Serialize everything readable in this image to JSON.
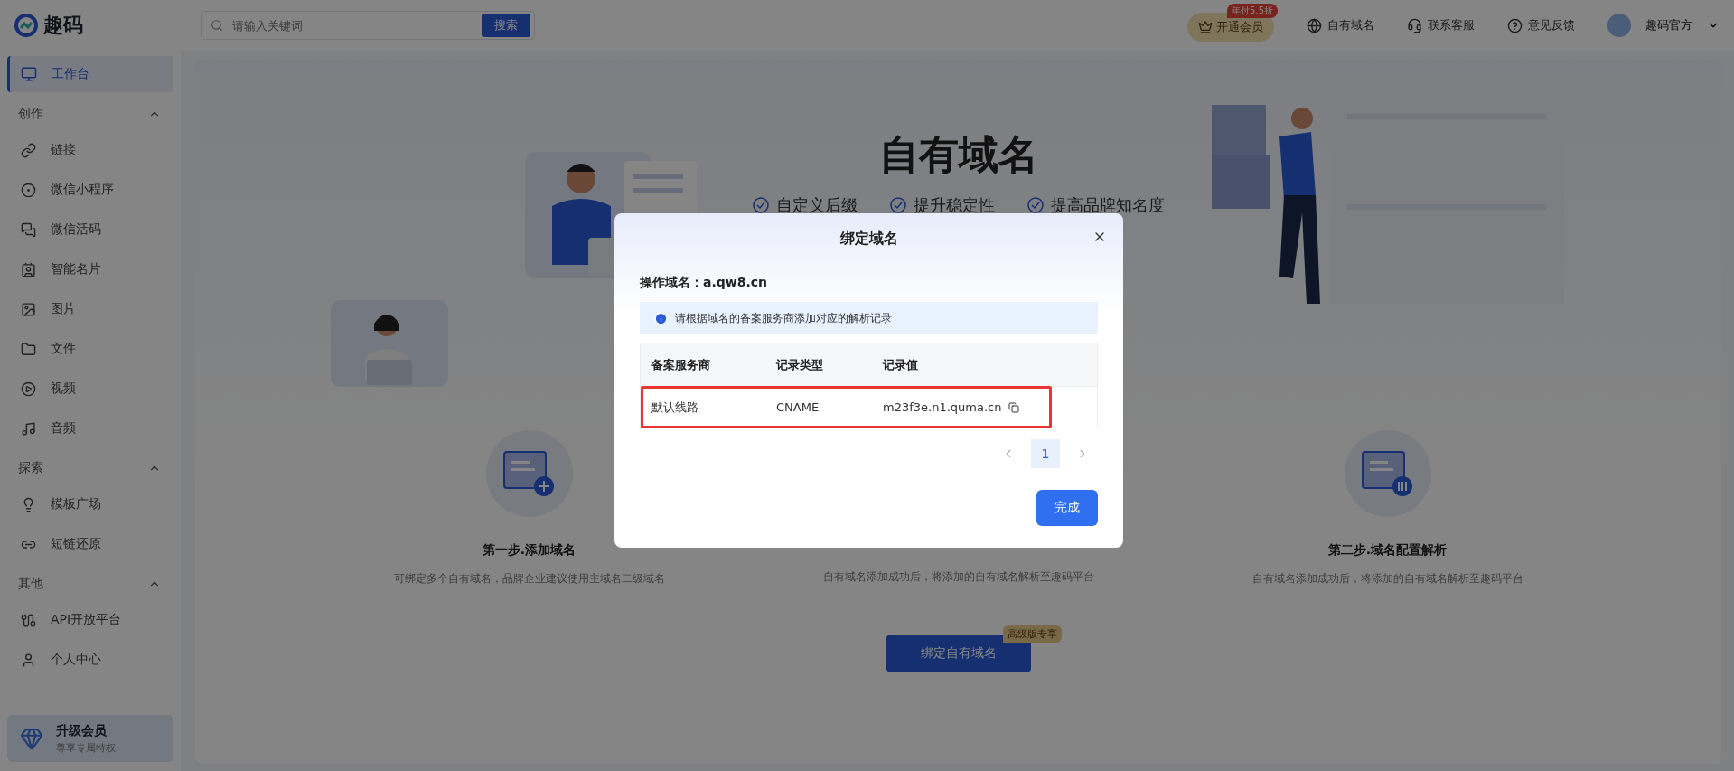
{
  "header": {
    "logo": "趣码",
    "search": {
      "placeholder": "请输入关键词",
      "button": "搜索"
    },
    "vip": {
      "label": "开通会员",
      "badge": "年付5.5折"
    },
    "links": [
      {
        "label": "自有域名"
      },
      {
        "label": "联系客服"
      },
      {
        "label": "意见反馈"
      }
    ],
    "user": "趣码官方"
  },
  "sidebar": {
    "top": {
      "label": "工作台",
      "selected": true
    },
    "groups": [
      {
        "title": "创作",
        "expanded": true,
        "items": [
          {
            "label": "链接",
            "selected": false
          },
          {
            "label": "微信小程序",
            "selected": false
          },
          {
            "label": "微信活码",
            "selected": false
          },
          {
            "label": "智能名片",
            "selected": false
          },
          {
            "label": "图片",
            "selected": false
          },
          {
            "label": "文件",
            "selected": false
          },
          {
            "label": "视频",
            "selected": false
          },
          {
            "label": "音频",
            "selected": false
          }
        ]
      },
      {
        "title": "探索",
        "expanded": true,
        "items": [
          {
            "label": "模板广场",
            "selected": false
          },
          {
            "label": "短链还原",
            "selected": false
          }
        ]
      },
      {
        "title": "其他",
        "expanded": true,
        "items": [
          {
            "label": "API开放平台",
            "selected": false
          },
          {
            "label": "个人中心",
            "selected": false
          }
        ]
      }
    ],
    "upgrade": {
      "title": "升级会员",
      "subtitle": "尊享专属特权"
    }
  },
  "hero": {
    "title": "自有域名",
    "features": [
      "自定义后缀",
      "提升稳定性",
      "提高品牌知名度"
    ]
  },
  "steps": [
    {
      "title": "第一步.添加域名",
      "description": "可绑定多个自有域名，品牌企业建议使用主域名二级域名"
    },
    {
      "description": "自有域名添加成功后，将添加的自有域名解析至趣码平台"
    },
    {
      "title": "第二步.域名配置解析",
      "description": "自有域名添加成功后，将添加的自有域名解析至趣码平台"
    }
  ],
  "bind_button": {
    "label": "绑定自有域名",
    "badge": "高级版专享"
  },
  "modal": {
    "title": "绑定域名",
    "domain": "操作域名：a.qw8.cn",
    "notice": "请根据域名的备案服务商添加对应的解析记录",
    "table": {
      "columns": [
        "备案服务商",
        "记录类型",
        "记录值"
      ],
      "rows": [
        {
          "cells": [
            "默认线路",
            "CNAME",
            "m23f3e.n1.quma.cn"
          ],
          "highlighted": true
        }
      ]
    },
    "pages": [
      {
        "label": "1",
        "selected": true
      }
    ],
    "confirm": "完成"
  }
}
